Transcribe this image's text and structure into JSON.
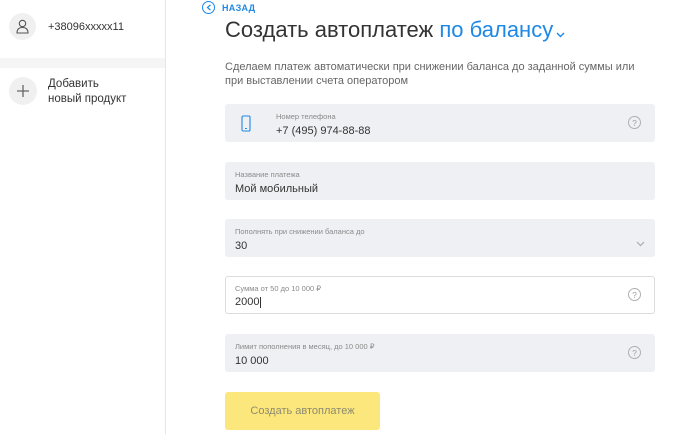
{
  "sidebar": {
    "account_number": "+38096xxxxx11",
    "add_product_line1": "Добавить",
    "add_product_line2": "новый продукт"
  },
  "header": {
    "back_label": "НАЗАД",
    "title_prefix": "Создать автоплатеж",
    "title_link": "по балансу",
    "description": "Сделаем платеж автоматически при снижении баланса до заданной суммы или при выставлении счета оператором"
  },
  "form": {
    "phone": {
      "label": "Номер телефона",
      "value": "+7 (495) 974-88-88",
      "help": "?"
    },
    "name": {
      "label": "Название платежа",
      "value": "Мой мобильный"
    },
    "threshold": {
      "label": "Пополнять при снижении баланса до",
      "value": "30"
    },
    "amount": {
      "label": "Сумма от 50 до 10 000 ₽",
      "value": "2000",
      "help": "?"
    },
    "limit": {
      "label": "Лимит пополнения в месяц, до 10 000 ₽",
      "value": "10 000",
      "help": "?"
    },
    "submit_label": "Создать автоплатеж"
  },
  "colors": {
    "accent": "#1e88e5",
    "button_disabled": "#fce77c",
    "field_bg": "#eef0f3"
  }
}
